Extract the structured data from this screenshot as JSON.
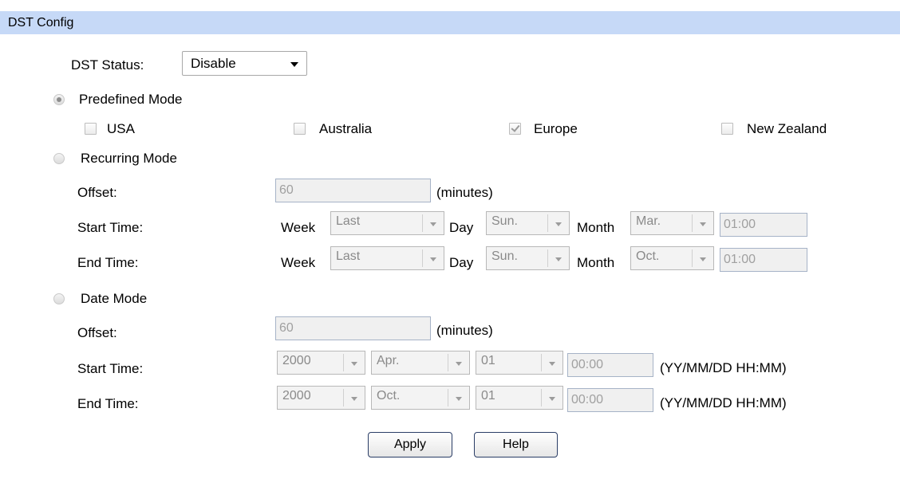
{
  "header": {
    "title": "DST Config"
  },
  "status": {
    "label": "DST Status:",
    "value": "Disable"
  },
  "predefined": {
    "label": "Predefined Mode",
    "selected": true,
    "options": [
      {
        "label": "USA",
        "checked": false
      },
      {
        "label": "Australia",
        "checked": false
      },
      {
        "label": "Europe",
        "checked": true
      },
      {
        "label": "New Zealand",
        "checked": false
      }
    ]
  },
  "recurring": {
    "label": "Recurring Mode",
    "selected": false,
    "offset_label": "Offset:",
    "offset_value": "60",
    "offset_unit": "(minutes)",
    "week_label": "Week",
    "day_label": "Day",
    "month_label": "Month",
    "start": {
      "label": "Start Time:",
      "week": "Last",
      "day": "Sun.",
      "month": "Mar.",
      "time": "01:00"
    },
    "end": {
      "label": "End Time:",
      "week": "Last",
      "day": "Sun.",
      "month": "Oct.",
      "time": "01:00"
    }
  },
  "date": {
    "label": "Date Mode",
    "selected": false,
    "offset_label": "Offset:",
    "offset_value": "60",
    "offset_unit": "(minutes)",
    "format_hint": "(YY/MM/DD HH:MM)",
    "start": {
      "label": "Start Time:",
      "year": "2000",
      "month": "Apr.",
      "day": "01",
      "time": "00:00"
    },
    "end": {
      "label": "End Time:",
      "year": "2000",
      "month": "Oct.",
      "day": "01",
      "time": "00:00"
    }
  },
  "buttons": {
    "apply": "Apply",
    "help": "Help"
  }
}
